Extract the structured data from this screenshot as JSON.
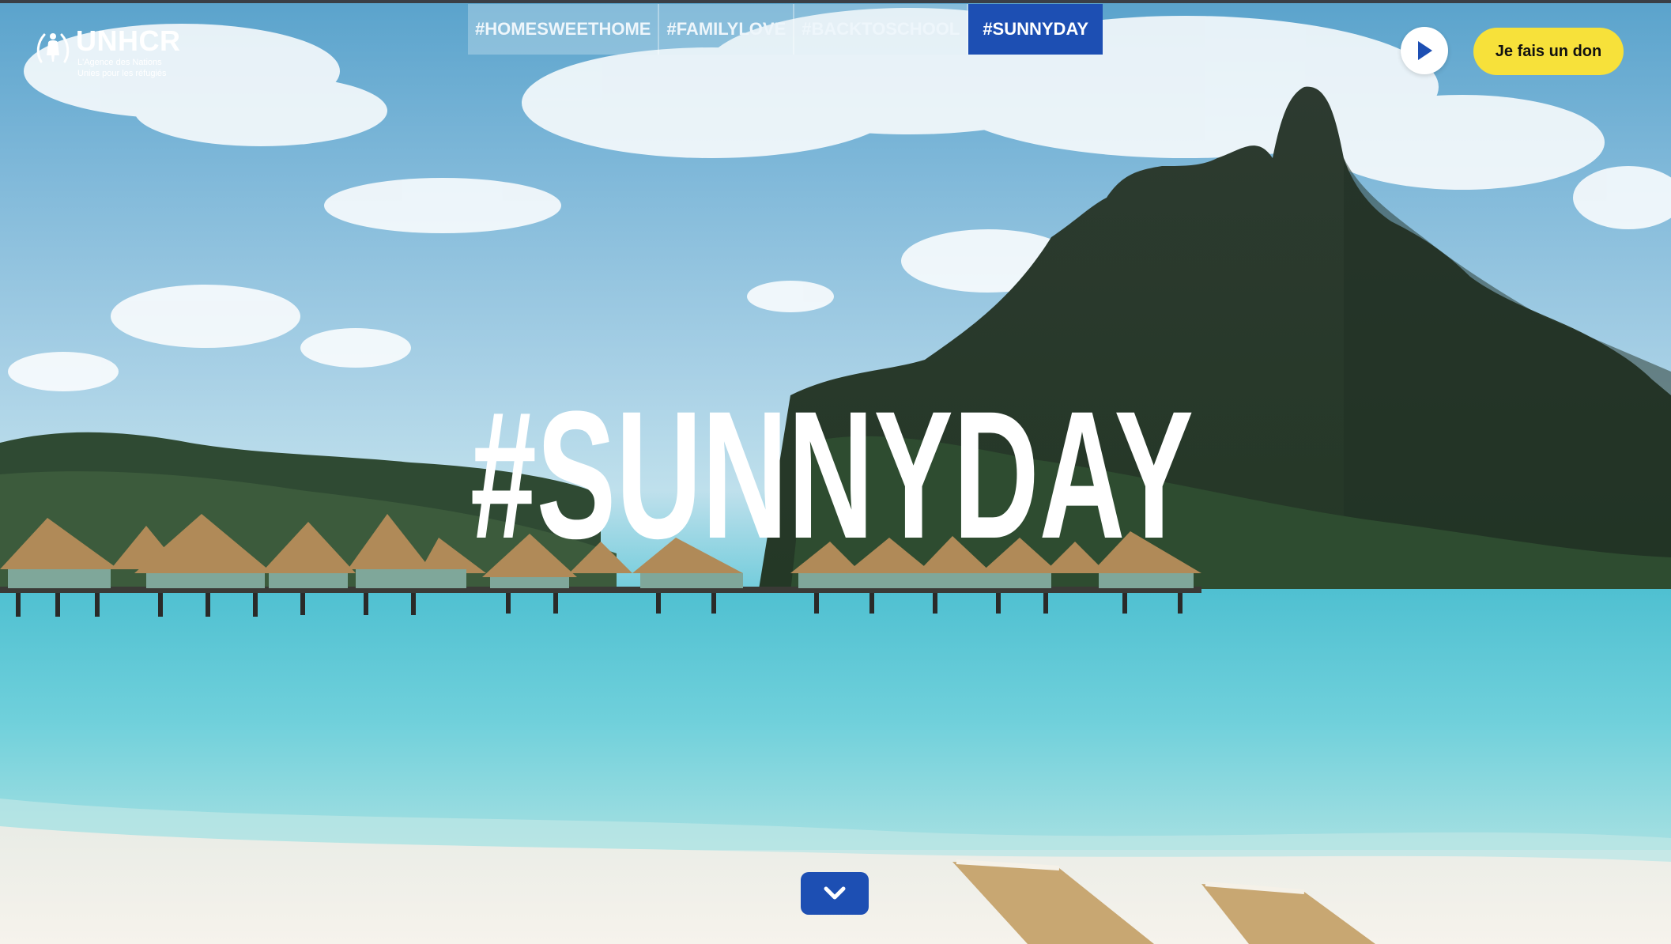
{
  "brand": {
    "name": "UNHCR",
    "tagline_line1": "L'Agence des Nations",
    "tagline_line2": "Unies pour les réfugiés"
  },
  "tabs": [
    {
      "label": "#HOMESWEETHOME",
      "active": false
    },
    {
      "label": "#FAMILYLOVE",
      "active": false
    },
    {
      "label": "#BACKTOSCHOOL",
      "active": false
    },
    {
      "label": "#SUNNYDAY",
      "active": true
    }
  ],
  "header": {
    "play_icon": "play-icon",
    "donate_label": "Je fais un don"
  },
  "hero": {
    "headline": "#SUNNYDAY",
    "background": "beach-with-overwater-bungalows-and-mountain"
  },
  "scroll_button": {
    "icon": "chevron-down-icon"
  },
  "colors": {
    "accent_blue": "#1d4fb3",
    "donate_yellow": "#f7e13a",
    "text_white": "#ffffff"
  }
}
